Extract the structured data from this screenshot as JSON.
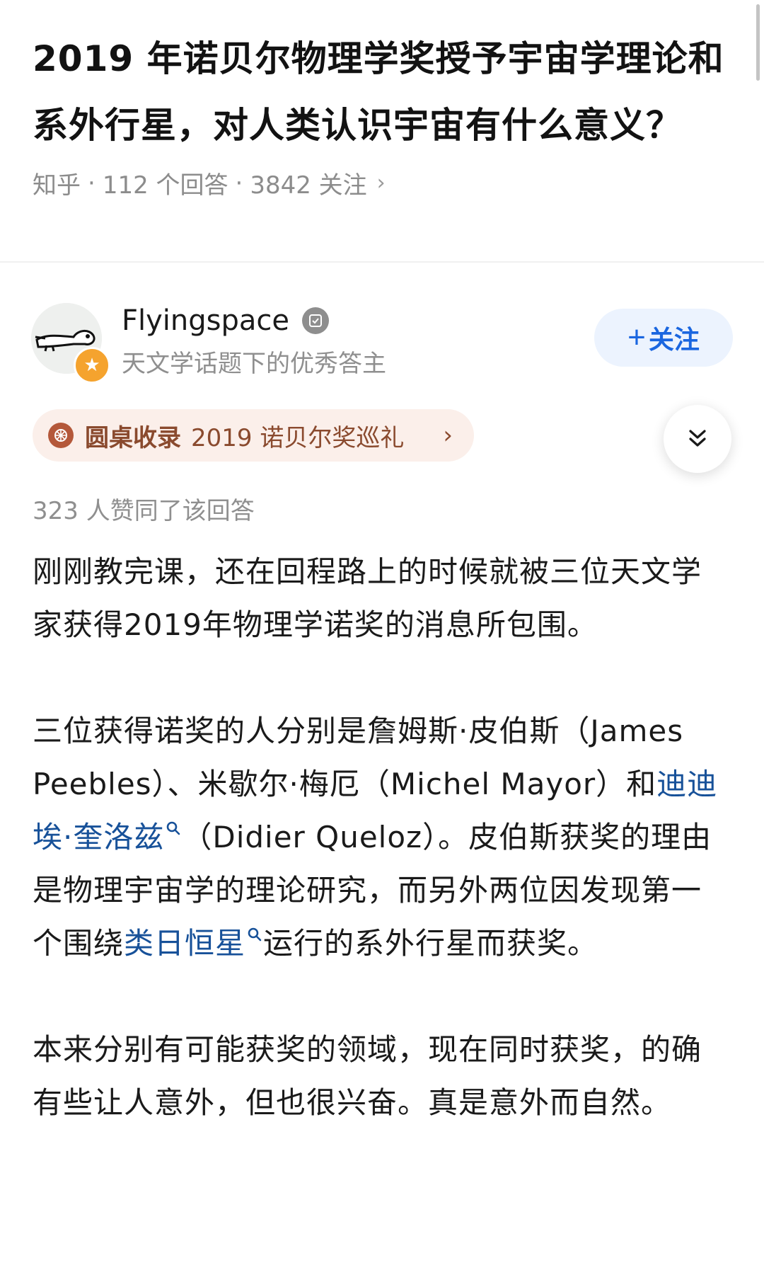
{
  "question": {
    "title": "2019 年诺贝尔物理学奖授予宇宙学理论和系外行星，对人类认识宇宙有什么意义？",
    "source": "知乎",
    "answers_count": "112 个回答",
    "followers_count": "3842 关注",
    "separator": "·",
    "chevron": "›"
  },
  "author": {
    "name": "Flyingspace",
    "subtitle": "天文学话题下的优秀答主",
    "follow_label": "关注",
    "follow_plus": "+",
    "badge_icon": "star-badge-icon",
    "verified_icon": "verified-icon"
  },
  "roundtable": {
    "label": "圆桌收录",
    "name": "2019 诺贝尔奖巡礼",
    "chevron": "›",
    "icon": "roundtable-icon"
  },
  "collapse": {
    "icon": "double-chevron-down-icon"
  },
  "vote_count": "323 人赞同了该回答",
  "answer": {
    "p1": "刚刚教完课，还在回程路上的时候就被三位天文学家获得2019年物理学诺奖的消息所包围。",
    "p2_a": "三位获得诺奖的人分别是詹姆斯·皮伯斯（James Peebles）、米歇尔·梅厄（Michel Mayor）和",
    "p2_link1": "迪迪埃·奎洛兹",
    "p2_b": "（Didier Queloz）。皮伯斯获奖的理由是物理宇宙学的理论研究，而另外两位因发现第一个围绕",
    "p2_link2": "类日恒星",
    "p2_c": "运行的系外行星而获奖。",
    "p3": "本来分别有可能获奖的领域，现在同时获奖，的确有些让人意外，但也很兴奋。真是意外而自然。"
  },
  "colors": {
    "link": "#175199",
    "follow_text": "#1a66e0",
    "follow_bg": "#ecf3fe",
    "tag_bg": "#fbefea",
    "tag_text": "#8a4a2e",
    "meta_gray": "#8f8f8f"
  }
}
